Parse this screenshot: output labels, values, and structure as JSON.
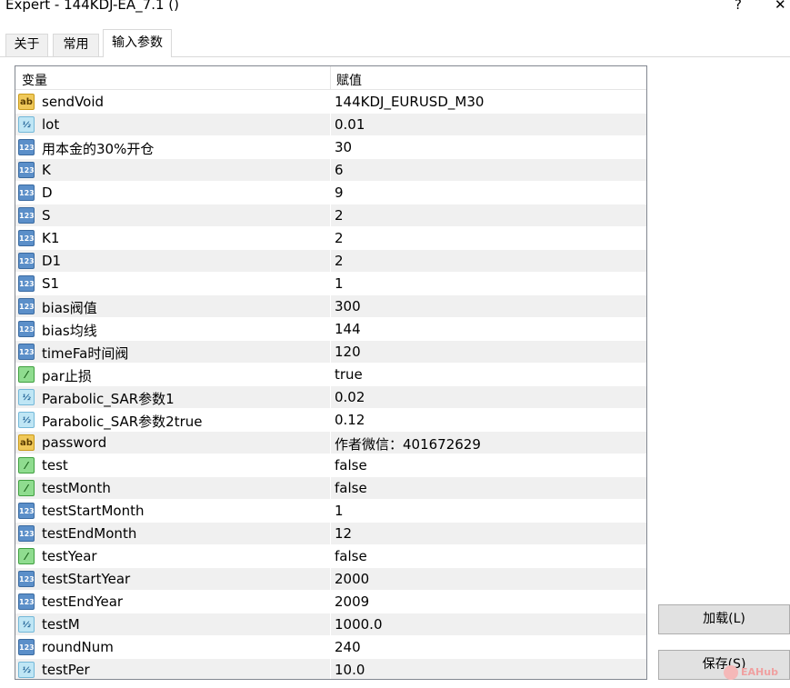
{
  "window": {
    "title": "Expert - 144KDJ-EA_7.1  ()",
    "help_glyph": "?",
    "close_glyph": "✕"
  },
  "tabs": [
    {
      "label": "关于",
      "active": false
    },
    {
      "label": "常用",
      "active": false
    },
    {
      "label": "输入参数",
      "active": true
    }
  ],
  "grid": {
    "col_variable": "变量",
    "col_value": "赋值",
    "rows": [
      {
        "name": "sendVoid",
        "value": "144KDJ_EURUSD_M30",
        "type": "string",
        "icon": "ab"
      },
      {
        "name": "lot",
        "value": "0.01",
        "type": "double",
        "icon": "½"
      },
      {
        "name": "用本金的30%开仓",
        "value": "30",
        "type": "int",
        "icon": "123"
      },
      {
        "name": "K",
        "value": "6",
        "type": "int",
        "icon": "123"
      },
      {
        "name": "D",
        "value": "9",
        "type": "int",
        "icon": "123"
      },
      {
        "name": "S",
        "value": "2",
        "type": "int",
        "icon": "123"
      },
      {
        "name": "K1",
        "value": "2",
        "type": "int",
        "icon": "123"
      },
      {
        "name": "D1",
        "value": "2",
        "type": "int",
        "icon": "123"
      },
      {
        "name": "S1",
        "value": "1",
        "type": "int",
        "icon": "123"
      },
      {
        "name": "bias阀值",
        "value": "300",
        "type": "int",
        "icon": "123"
      },
      {
        "name": "bias均线",
        "value": "144",
        "type": "int",
        "icon": "123"
      },
      {
        "name": "timeFa时间阀",
        "value": "120",
        "type": "int",
        "icon": "123"
      },
      {
        "name": "par止损",
        "value": "true",
        "type": "bool",
        "icon": "⁄"
      },
      {
        "name": "Parabolic_SAR参数1",
        "value": "0.02",
        "type": "double",
        "icon": "½"
      },
      {
        "name": "Parabolic_SAR参数2true",
        "value": "0.12",
        "type": "double",
        "icon": "½"
      },
      {
        "name": "password",
        "value": "作者微信：401672629",
        "type": "string",
        "icon": "ab"
      },
      {
        "name": "test",
        "value": "false",
        "type": "bool",
        "icon": "⁄"
      },
      {
        "name": "testMonth",
        "value": "false",
        "type": "bool",
        "icon": "⁄"
      },
      {
        "name": "testStartMonth",
        "value": "1",
        "type": "int",
        "icon": "123"
      },
      {
        "name": "testEndMonth",
        "value": "12",
        "type": "int",
        "icon": "123"
      },
      {
        "name": "testYear",
        "value": "false",
        "type": "bool",
        "icon": "⁄"
      },
      {
        "name": "testStartYear",
        "value": "2000",
        "type": "int",
        "icon": "123"
      },
      {
        "name": "testEndYear",
        "value": "2009",
        "type": "int",
        "icon": "123"
      },
      {
        "name": "testM",
        "value": "1000.0",
        "type": "double",
        "icon": "½"
      },
      {
        "name": "roundNum",
        "value": "240",
        "type": "int",
        "icon": "123"
      },
      {
        "name": "testPer",
        "value": "10.0",
        "type": "double",
        "icon": "½"
      }
    ]
  },
  "buttons": {
    "load_label": "加载(L)",
    "save_label": "保存(S)"
  },
  "watermark": "EAHub"
}
